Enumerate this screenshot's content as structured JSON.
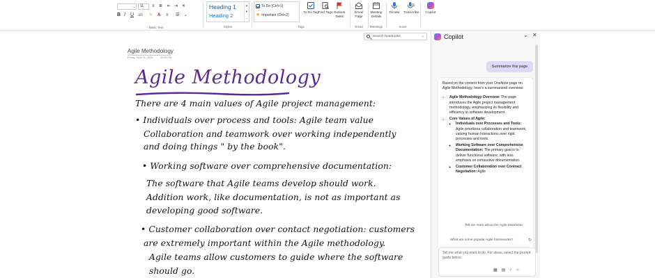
{
  "ribbon": {
    "groups": {
      "basic_text": "Basic Text",
      "styles": "Styles",
      "tags": "Tags",
      "email": "Email",
      "meetings": "Meetings",
      "voice": "Voice"
    },
    "font_size": "11",
    "styles": {
      "heading1": "Heading 1",
      "heading2": "Heading 2"
    },
    "tags": {
      "todo": "To Do (Ctrl+1)",
      "important": "Important (Ctrl+2)"
    },
    "buttons": {
      "todo_tag": "To Do Tag",
      "find_tags": "Find Tags",
      "outlook_tasks": "Outlook Tasks",
      "email_page": "Email Page",
      "meeting_details": "Meeting Details",
      "dictate": "Dictate",
      "transcribe": "Transcribe",
      "copilot": "Copilot"
    }
  },
  "search": {
    "placeholder": "Search Notebooks"
  },
  "page": {
    "title": "Agile Methodology",
    "date": "Friday, June 21, 2024",
    "time": "10:05 PM",
    "ink_title": "Agile Methodology",
    "lines": [
      "There are 4 main values of Agile project management:",
      "• Individuals over process and tools: Agile team value",
      "Collaboration and teamwork over working independently",
      "and doing things \" by the book\".",
      "• Working software over comprehensive documentation:",
      "The software that Agile teams develop should work.",
      "Addition work, like documentation, is not as important as",
      "developing good software.",
      "• Customer collaboration over contact negotiation: customers",
      "are extremely important within the Agile methodology.",
      "Agile teams allow customers to guide where the software",
      "should go."
    ]
  },
  "copilot": {
    "title": "Copilot",
    "user_message": "Summarize this page",
    "response": {
      "intro": "Based on the content from your OneNote page on Agile Methodology, here's a summarized overview:",
      "overview_heading": "Agile Methodology Overview:",
      "overview_text": "The page introduces the Agile project management methodology, emphasizing its flexibility and efficiency in software development.",
      "core_heading": "Core Values of Agile:",
      "values": [
        {
          "heading": "Individuals over Processes and Tools:",
          "text": "Agile prioritizes collaboration and teamwork, valuing human interactions over rigid processes and tools."
        },
        {
          "heading": "Working Software over Comprehensive Documentation:",
          "text": "The primary goal is to deliver functional software, with less emphasis on exhaustive documentation."
        },
        {
          "heading": "Customer Collaboration over Contract Negotiation:",
          "text": "Agile"
        }
      ]
    },
    "suggestions": [
      "Tell me more about the Agile Manifesto",
      "What are some popular Agile frameworks?"
    ],
    "compose_placeholder": "Tell me what you want to do. For ideas, select the prompt guide below."
  }
}
